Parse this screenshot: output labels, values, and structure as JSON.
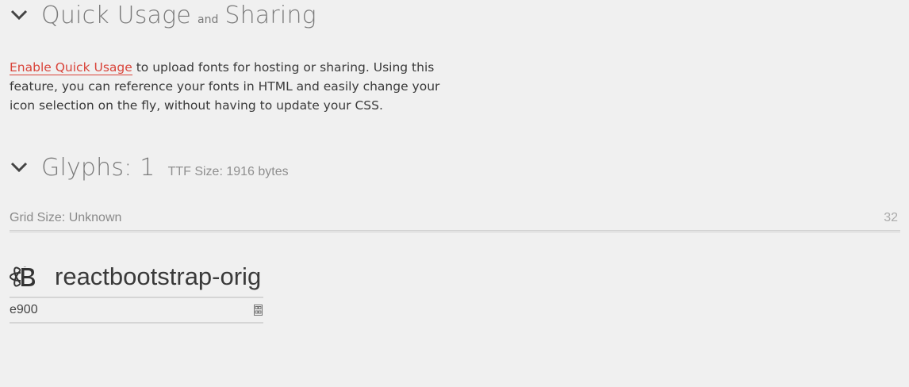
{
  "quick_usage": {
    "title_part1": "Quick Usage",
    "title_connector": "and",
    "title_part2": "Sharing",
    "link_text": "Enable Quick Usage",
    "body_text": " to upload fonts for hosting or sharing. Using this feature, you can reference your fonts in HTML and easily change your icon selection on the fly, without having to update your CSS."
  },
  "glyphs": {
    "title": "Glyphs: 1",
    "ttf_size": "TTF Size: 1916 bytes",
    "grid_size_label": "Grid Size: Unknown",
    "grid_size_value": "32",
    "items": [
      {
        "name": "reactbootstrap-orig",
        "code": "e900",
        "icon": "react-bootstrap-icon"
      }
    ]
  },
  "icons": {
    "section_toggle": "chevron-down-icon",
    "code_toggle": "codepoint-icon"
  },
  "colors": {
    "link": "#d9443a",
    "heading": "#7a7a7a",
    "background": "#f0f0f0"
  }
}
